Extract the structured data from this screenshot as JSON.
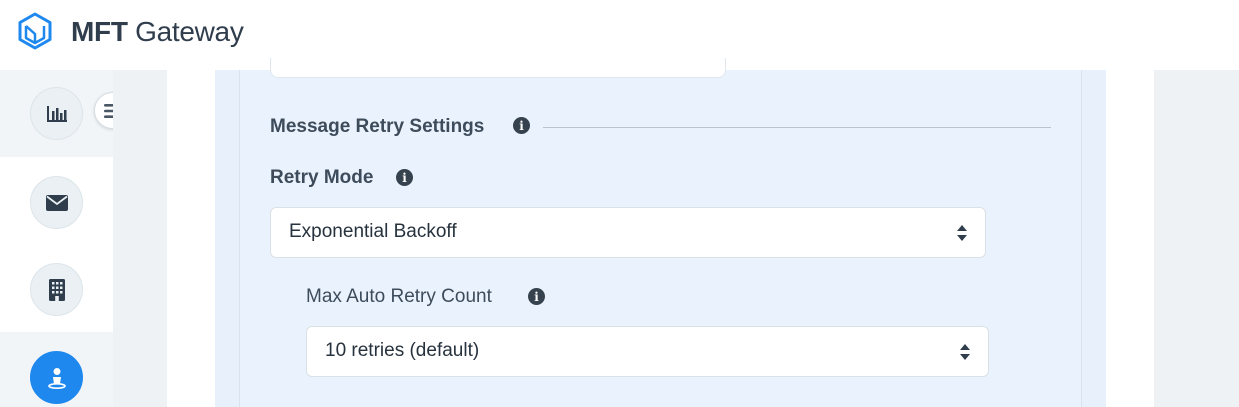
{
  "app": {
    "brand_bold": "MFT",
    "brand_rest": " Gateway",
    "logo_icon": "hexagon-logo-icon"
  },
  "sidebar": {
    "items": [
      {
        "name": "dashboard",
        "icon": "bar-chart-icon",
        "active": true
      },
      {
        "name": "messages",
        "icon": "envelope-icon",
        "active": false
      },
      {
        "name": "organizations",
        "icon": "building-icon",
        "active": false
      },
      {
        "name": "user",
        "icon": "user-icon",
        "active": true
      }
    ],
    "toggle_icon": "hamburger-menu-icon"
  },
  "form": {
    "section_title": "Message Retry Settings",
    "retry_mode": {
      "label": "Retry Mode",
      "value": "Exponential Backoff"
    },
    "max_retry": {
      "label": "Max Auto Retry Count",
      "value": "10 retries (default)"
    }
  },
  "colors": {
    "accent": "#1e88ef",
    "panel": "#eaf3fd",
    "text": "#3d4b5b"
  }
}
